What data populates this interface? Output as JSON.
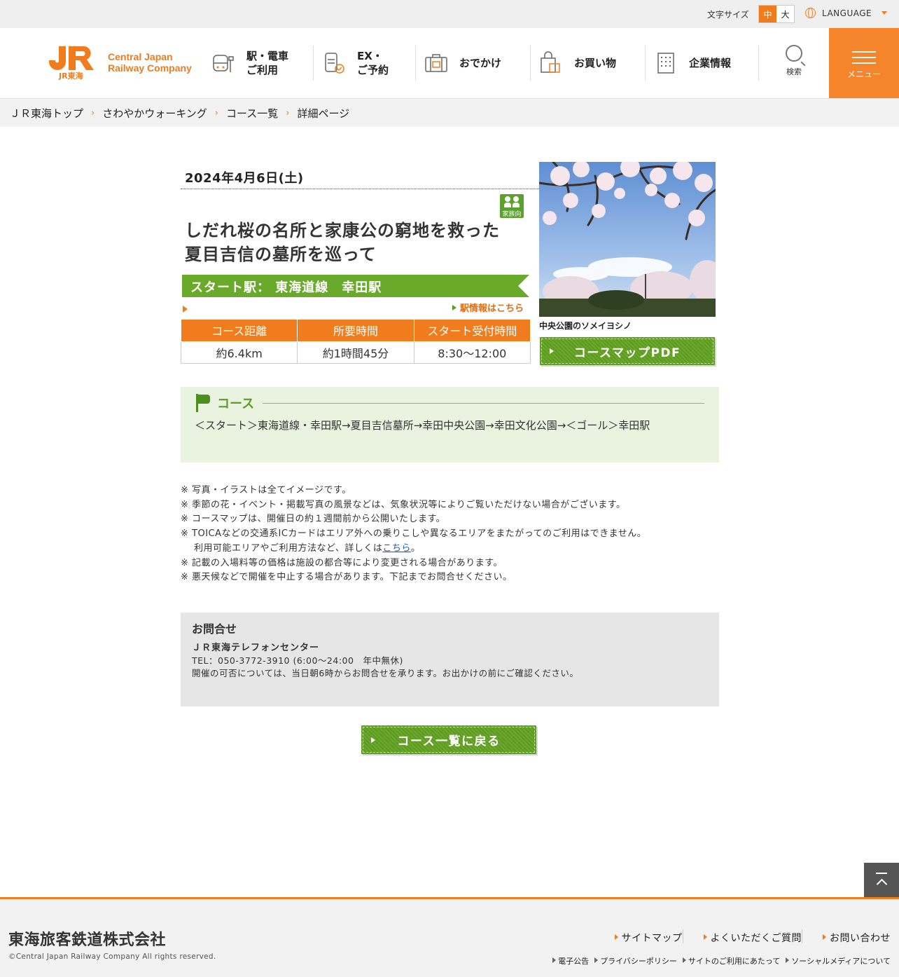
{
  "utility": {
    "font_size_label": "文字サイズ",
    "font_sizes": [
      "中",
      "大"
    ],
    "language": "LANGUAGE"
  },
  "header": {
    "logo_text_line1": "Central Japan",
    "logo_text_line2": "Railway Company",
    "logo_mark_text": "JR東海",
    "nav": [
      {
        "label_line1": "駅・電車",
        "label_line2": "ご利用",
        "icon": "train-icon"
      },
      {
        "label_line1": "EX・",
        "label_line2": "ご予約",
        "icon": "reservation-icon"
      },
      {
        "label_line1": "おでかけ",
        "label_line2": "",
        "icon": "suitcase-icon"
      },
      {
        "label_line1": "お買い物",
        "label_line2": "",
        "icon": "shopping-bag-icon"
      },
      {
        "label_line1": "企業情報",
        "label_line2": "",
        "icon": "building-icon"
      }
    ],
    "search_label": "検索",
    "menu_label": "メニュー",
    "accent_color": "#f07c1e"
  },
  "breadcrumb": [
    "ＪＲ東海トップ",
    "さわやかウォーキング",
    "コース一覧",
    "詳細ページ"
  ],
  "event": {
    "date": "2024年4月6日(土)",
    "family_badge": "家族向",
    "title_line1": "しだれ桜の名所と家康公の窮地を救った",
    "title_line2": "夏目吉信の墓所を巡って",
    "start_station": "スタート駅：  東海道線　幸田駅",
    "station_link": "駅情報はこちら",
    "table_headers": [
      "コース距離",
      "所要時間",
      "スタート受付時間"
    ],
    "table_values": [
      "約6.4km",
      "約1時間45分",
      "8:30～12:00"
    ],
    "photo_caption": "中央公園のソメイヨシノ",
    "pdf_button": "コースマップPDF",
    "green_color": "#6aaa2a"
  },
  "course": {
    "heading": "コース",
    "route": "＜スタート＞東海道線・幸田駅→夏目吉信墓所→幸田中央公園→幸田文化公園→＜ゴール＞幸田駅"
  },
  "notes": [
    "※ 写真・イラストは全てイメージです。",
    "※ 季節の花・イベント・掲載写真の風景などは、気象状況等によりご覧いただけない場合がございます。",
    "※ コースマップは、開催日の約１週間前から公開いたします。",
    "※ TOICAなどの交通系ICカードはエリア外への乗りこしや異なるエリアをまたがってのご利用はできません。",
    "※ 記載の入場料等の価格は施設の都合等により変更される場合があります。",
    "※ 悪天候などで開催を中止する場合があります。下記までお問合せください。"
  ],
  "notes_extra_prefix": "利用可能エリアやご利用方法など、詳しくは",
  "notes_extra_link": "こちら",
  "notes_extra_suffix": "。",
  "contact": {
    "title": "お問合せ",
    "name": "ＪＲ東海テレフォンセンター",
    "tel": "TEL：050-3772-3910 (6:00～24:00　年中無休)",
    "note": "開催の可否については、当日朝6時からお問合せを承ります。お出かけの前にご確認ください。"
  },
  "back_button": "コース一覧に戻る",
  "footer": {
    "company": "東海旅客鉄道株式会社",
    "copyright": "©Central Japan Railway Company All rights reserved.",
    "links": [
      "サイトマップ",
      "よくいただくご質問",
      "お問い合わせ"
    ],
    "sub_links": [
      "電子公告",
      "プライバシーポリシー",
      "サイトのご利用にあたって",
      "ソーシャルメディアについて"
    ]
  }
}
